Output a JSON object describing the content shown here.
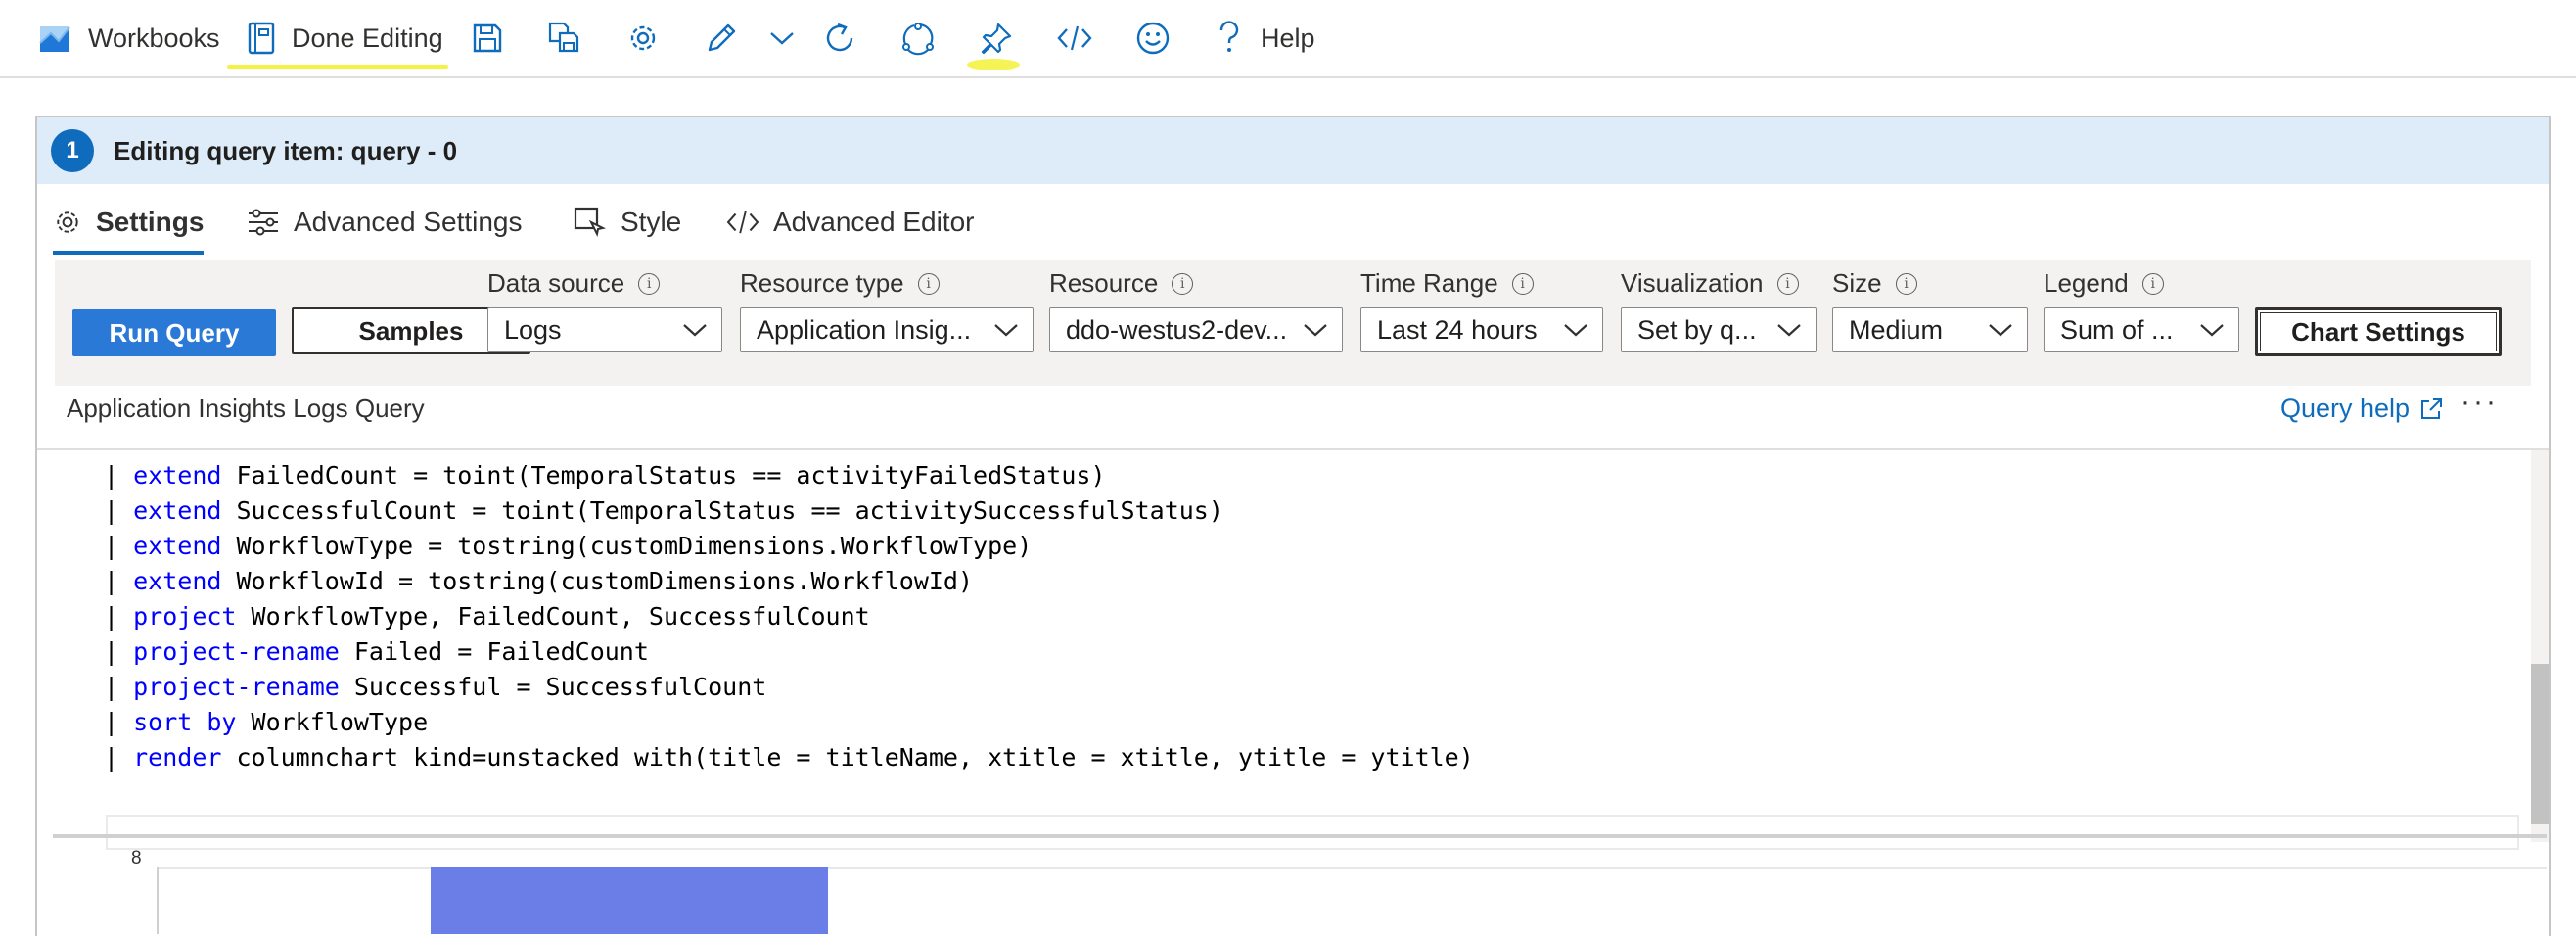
{
  "toolbar": {
    "workbooks_label": "Workbooks",
    "done_editing_label": "Done Editing",
    "help_label": "Help"
  },
  "panel": {
    "step_number": "1",
    "title": "Editing query item: query - 0",
    "tabs": [
      {
        "label": "Settings",
        "active": true
      },
      {
        "label": "Advanced Settings",
        "active": false
      },
      {
        "label": "Style",
        "active": false
      },
      {
        "label": "Advanced Editor",
        "active": false
      }
    ]
  },
  "settings": {
    "run_query_label": "Run Query",
    "samples_label": "Samples",
    "chart_settings_label": "Chart Settings",
    "fields": {
      "data_source": {
        "label": "Data source",
        "value": "Logs"
      },
      "resource_type": {
        "label": "Resource type",
        "value": "Application Insig..."
      },
      "resource": {
        "label": "Resource",
        "value": "ddo-westus2-dev..."
      },
      "time_range": {
        "label": "Time Range",
        "value": "Last 24 hours"
      },
      "visualization": {
        "label": "Visualization",
        "value": "Set by q..."
      },
      "size": {
        "label": "Size",
        "value": "Medium"
      },
      "legend": {
        "label": "Legend",
        "value": "Sum of ..."
      }
    }
  },
  "query": {
    "title": "Application Insights Logs Query",
    "help_label": "Query help",
    "more_label": "···",
    "lines": [
      {
        "kw": "extend",
        "rest": " FailedCount = toint(TemporalStatus == activityFailedStatus)"
      },
      {
        "kw": "extend",
        "rest": " SuccessfulCount = toint(TemporalStatus == activitySuccessfulStatus)"
      },
      {
        "kw": "extend",
        "rest": " WorkflowType = tostring(customDimensions.WorkflowType)"
      },
      {
        "kw": "extend",
        "rest": " WorkflowId = tostring(customDimensions.WorkflowId)"
      },
      {
        "kw": "project",
        "rest": " WorkflowType, FailedCount, SuccessfulCount"
      },
      {
        "kw": "project-rename",
        "rest": " Failed = FailedCount"
      },
      {
        "kw": "project-rename",
        "rest": " Successful = SuccessfulCount"
      },
      {
        "kw": "sort by",
        "rest": " WorkflowType"
      },
      {
        "kw": "render",
        "rest": " columnchart kind=unstacked with(title = titleName, xtitle = xtitle, ytitle = ytitle)"
      }
    ]
  },
  "chart_data": {
    "type": "bar",
    "y_ticks": [
      "8"
    ],
    "bar_color": "#6b7de6",
    "visible_bars": [
      {
        "value_at_least": 8
      }
    ]
  },
  "colors": {
    "accent": "#0f6cbd",
    "run_query": "#2b79d6",
    "header_bg": "#deecf9",
    "highlight": "#f5f245"
  },
  "icons": [
    "workbook-icon",
    "edit-book-icon",
    "save-icon",
    "save-as-icon",
    "gear-icon",
    "pencil-icon",
    "chevron-down-icon",
    "refresh-icon",
    "share-icon",
    "pin-icon",
    "code-icon",
    "smiley-icon",
    "help-icon"
  ]
}
